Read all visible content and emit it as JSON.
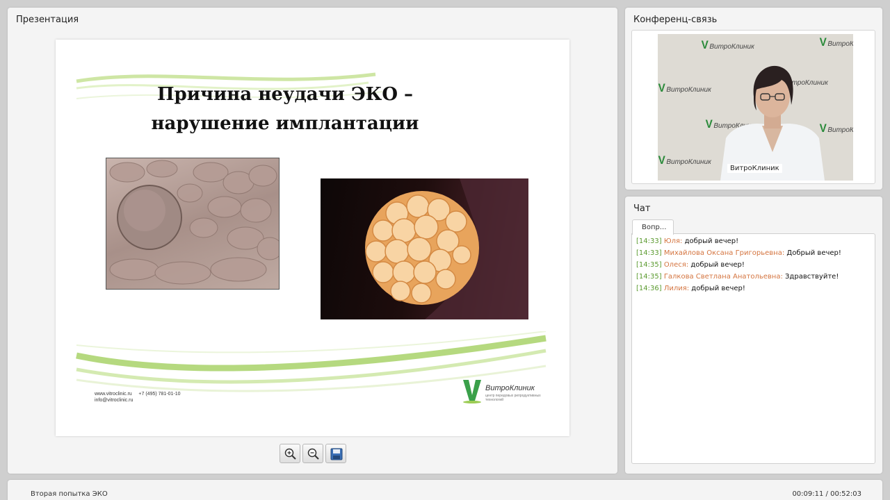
{
  "presentation": {
    "title": "Презентация",
    "slide": {
      "title": "Причина неудачи ЭКО – нарушение имплантации",
      "footer_site": "www.vitroclinic.ru",
      "footer_phone": "+7 (495) 781-01-10",
      "footer_email": "info@vitroclinic.ru",
      "logo_text": "ВитроКлиник",
      "logo_subtext": "центр передовых репродуктивных технологий"
    },
    "toolbar": {
      "zoom_in_icon": "zoom-in-icon",
      "zoom_out_icon": "zoom-out-icon",
      "save_icon": "save-icon"
    }
  },
  "conference": {
    "title": "Конференц-связь",
    "video_label": "ВитроКлиник",
    "watermark": "ВитроКлиник"
  },
  "chat": {
    "title": "Чат",
    "tab_label": "Вопр...",
    "messages": [
      {
        "time": "[14:33]",
        "name": "Юля:",
        "text": "добрый вечер!"
      },
      {
        "time": "[14:33]",
        "name": "Михайлова Оксана Григорьевна:",
        "text": "Добрый вечер!"
      },
      {
        "time": "[14:35]",
        "name": "Олеся:",
        "text": "добрый вечер!"
      },
      {
        "time": "[14:35]",
        "name": "Галкова Светлана Анатольевна:",
        "text": "Здравствуйте!"
      },
      {
        "time": "[14:36]",
        "name": "Лилия:",
        "text": "добрый вечер!"
      }
    ]
  },
  "bottom": {
    "title": "Вторая попытка ЭКО",
    "time": "00:09:11 / 00:52:03"
  },
  "colors": {
    "time": "#5a9a2e",
    "name": "#d4743f",
    "brand_green": "#2a8a3a"
  }
}
